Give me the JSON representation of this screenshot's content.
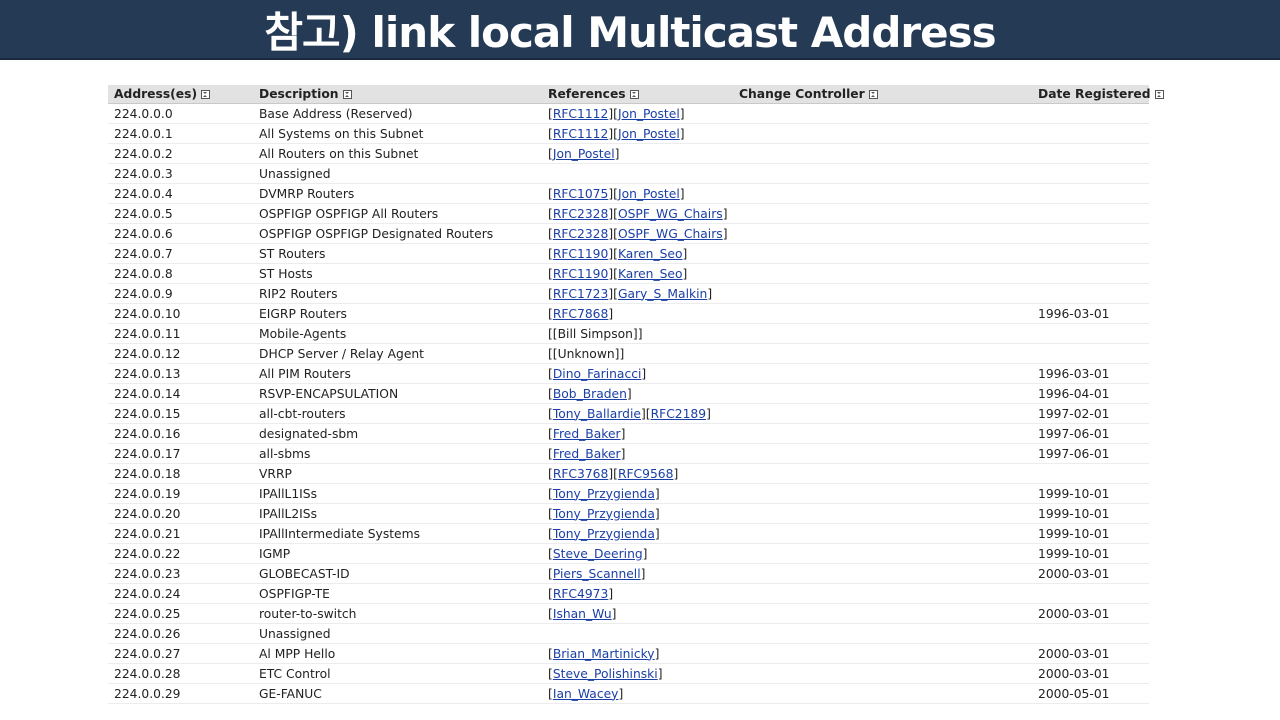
{
  "title": "참고) link local Multicast Address",
  "columns": [
    "Address(es)",
    "Description",
    "References",
    "Change Controller",
    "Date Registered"
  ],
  "rows": [
    {
      "address": "224.0.0.0",
      "description": "Base Address (Reserved)",
      "references": [
        "RFC1112",
        "Jon_Postel"
      ],
      "date": ""
    },
    {
      "address": "224.0.0.1",
      "description": "All Systems on this Subnet",
      "references": [
        "RFC1112",
        "Jon_Postel"
      ],
      "date": ""
    },
    {
      "address": "224.0.0.2",
      "description": "All Routers on this Subnet",
      "references": [
        "Jon_Postel"
      ],
      "date": ""
    },
    {
      "address": "224.0.0.3",
      "description": "Unassigned",
      "references": [],
      "date": ""
    },
    {
      "address": "224.0.0.4",
      "description": "DVMRP Routers",
      "references": [
        "RFC1075",
        "Jon_Postel"
      ],
      "date": ""
    },
    {
      "address": "224.0.0.5",
      "description": "OSPFIGP OSPFIGP All Routers",
      "references": [
        "RFC2328",
        "OSPF_WG_Chairs"
      ],
      "date": ""
    },
    {
      "address": "224.0.0.6",
      "description": "OSPFIGP OSPFIGP Designated Routers",
      "references": [
        "RFC2328",
        "OSPF_WG_Chairs"
      ],
      "date": ""
    },
    {
      "address": "224.0.0.7",
      "description": "ST Routers",
      "references": [
        "RFC1190",
        "Karen_Seo"
      ],
      "date": ""
    },
    {
      "address": "224.0.0.8",
      "description": "ST Hosts",
      "references": [
        "RFC1190",
        "Karen_Seo"
      ],
      "date": ""
    },
    {
      "address": "224.0.0.9",
      "description": "RIP2 Routers",
      "references": [
        "RFC1723",
        "Gary_S_Malkin"
      ],
      "date": ""
    },
    {
      "address": "224.0.0.10",
      "description": "EIGRP Routers",
      "references": [
        "RFC7868"
      ],
      "date": "1996-03-01"
    },
    {
      "address": "224.0.0.11",
      "description": "Mobile-Agents",
      "references_text": "[[Bill Simpson]]",
      "date": ""
    },
    {
      "address": "224.0.0.12",
      "description": "DHCP Server / Relay Agent",
      "references_text": "[[Unknown]]",
      "date": ""
    },
    {
      "address": "224.0.0.13",
      "description": "All PIM Routers",
      "references": [
        "Dino_Farinacci"
      ],
      "date": "1996-03-01"
    },
    {
      "address": "224.0.0.14",
      "description": "RSVP-ENCAPSULATION",
      "references": [
        "Bob_Braden"
      ],
      "date": "1996-04-01"
    },
    {
      "address": "224.0.0.15",
      "description": "all-cbt-routers",
      "references": [
        "Tony_Ballardie",
        "RFC2189"
      ],
      "date": "1997-02-01"
    },
    {
      "address": "224.0.0.16",
      "description": "designated-sbm",
      "references": [
        "Fred_Baker"
      ],
      "date": "1997-06-01"
    },
    {
      "address": "224.0.0.17",
      "description": "all-sbms",
      "references": [
        "Fred_Baker"
      ],
      "date": "1997-06-01"
    },
    {
      "address": "224.0.0.18",
      "description": "VRRP",
      "references": [
        "RFC3768",
        "RFC9568"
      ],
      "date": ""
    },
    {
      "address": "224.0.0.19",
      "description": "IPAllL1ISs",
      "references": [
        "Tony_Przygienda"
      ],
      "date": "1999-10-01"
    },
    {
      "address": "224.0.0.20",
      "description": "IPAllL2ISs",
      "references": [
        "Tony_Przygienda"
      ],
      "date": "1999-10-01"
    },
    {
      "address": "224.0.0.21",
      "description": "IPAllIntermediate Systems",
      "references": [
        "Tony_Przygienda"
      ],
      "date": "1999-10-01"
    },
    {
      "address": "224.0.0.22",
      "description": "IGMP",
      "references": [
        "Steve_Deering"
      ],
      "date": "1999-10-01"
    },
    {
      "address": "224.0.0.23",
      "description": "GLOBECAST-ID",
      "references": [
        "Piers_Scannell"
      ],
      "date": "2000-03-01"
    },
    {
      "address": "224.0.0.24",
      "description": "OSPFIGP-TE",
      "references": [
        "RFC4973"
      ],
      "date": ""
    },
    {
      "address": "224.0.0.25",
      "description": "router-to-switch",
      "references": [
        "Ishan_Wu"
      ],
      "date": "2000-03-01"
    },
    {
      "address": "224.0.0.26",
      "description": "Unassigned",
      "references": [],
      "date": ""
    },
    {
      "address": "224.0.0.27",
      "description": "Al MPP Hello",
      "references": [
        "Brian_Martinicky"
      ],
      "date": "2000-03-01"
    },
    {
      "address": "224.0.0.28",
      "description": "ETC Control",
      "references": [
        "Steve_Polishinski"
      ],
      "date": "2000-03-01"
    },
    {
      "address": "224.0.0.29",
      "description": "GE-FANUC",
      "references": [
        "Ian_Wacey"
      ],
      "date": "2000-05-01"
    }
  ]
}
